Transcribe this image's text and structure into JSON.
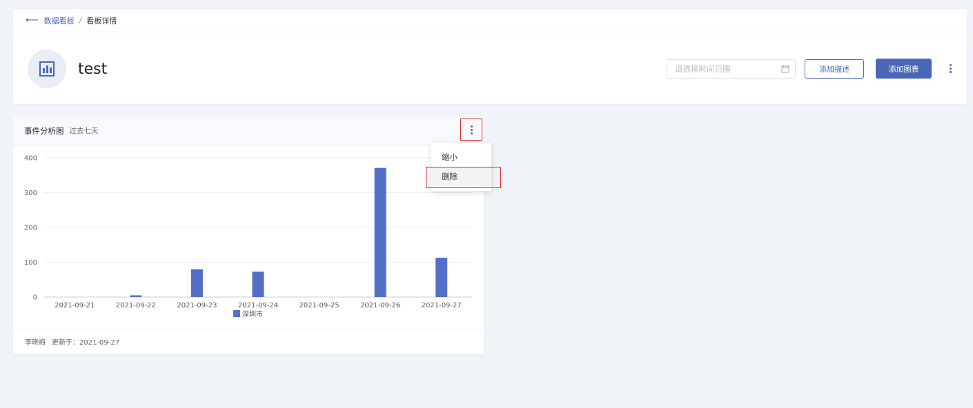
{
  "breadcrumb": {
    "back_icon": "arrow-left-icon",
    "parent": "数据看板",
    "separator": "/",
    "current": "看板详情"
  },
  "board": {
    "icon": "bar-chart-icon",
    "title": "test"
  },
  "toolbar": {
    "date_placeholder": "请选择时间范围",
    "calendar_icon": "calendar-icon",
    "add_desc_label": "添加描述",
    "add_chart_label": "添加图表",
    "more_icon": "more-vertical-icon"
  },
  "chart_card": {
    "title": "事件分析图",
    "subtitle": "过去七天",
    "more_icon": "more-vertical-icon",
    "footer": {
      "author": "李晓梅",
      "updated": "更新于：2021-09-27"
    },
    "menu": {
      "items": [
        {
          "label": "缩小"
        },
        {
          "label": "删除"
        }
      ]
    }
  },
  "colors": {
    "primary": "#4a67b6",
    "bar": "#5470c6",
    "highlight": "#e02020"
  },
  "chart_data": {
    "type": "bar",
    "categories": [
      "2021-09-21",
      "2021-09-22",
      "2021-09-23",
      "2021-09-24",
      "2021-09-25",
      "2021-09-26",
      "2021-09-27"
    ],
    "series": [
      {
        "name": "深圳市",
        "values": [
          0,
          5,
          80,
          73,
          0,
          371,
          113
        ]
      }
    ],
    "ylim": [
      0,
      400
    ],
    "yticks": [
      0,
      100,
      200,
      300,
      400
    ],
    "grid": true,
    "legend": "bottom-center"
  }
}
